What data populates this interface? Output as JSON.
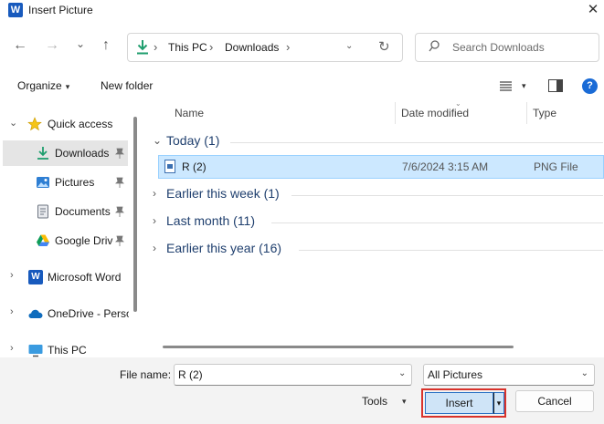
{
  "window": {
    "app_icon_letter": "W",
    "title": "Insert Picture",
    "close_glyph": "✕"
  },
  "nav": {
    "back_glyph": "←",
    "forward_glyph": "→",
    "recent_glyph": "⌄",
    "up_glyph": "↑",
    "address": [
      "This PC",
      "Downloads"
    ],
    "address_separator": "›",
    "address_dropdown_glyph": "⌄",
    "refresh_glyph": "↻",
    "search_placeholder": "Search Downloads"
  },
  "toolbar": {
    "organize": "Organize",
    "new_folder": "New folder",
    "caret": "▾",
    "help_glyph": "?"
  },
  "nav_pane": {
    "items": [
      {
        "label": "Quick access",
        "icon": "star-icon",
        "chevron": "⌄",
        "pinned": false
      },
      {
        "label": "Downloads",
        "icon": "download-icon",
        "chevron": "",
        "pinned": true,
        "selected": true
      },
      {
        "label": "Pictures",
        "icon": "pictures-icon",
        "chevron": "",
        "pinned": true
      },
      {
        "label": "Documents",
        "icon": "documents-icon",
        "chevron": "",
        "pinned": true
      },
      {
        "label": "Google Drive",
        "icon": "google-drive-icon",
        "chevron": "",
        "pinned": true
      },
      {
        "label": "Microsoft Word",
        "icon": "word-icon",
        "chevron": "›",
        "pinned": false
      },
      {
        "label": "OneDrive - Personal",
        "icon": "onedrive-icon",
        "chevron": "›",
        "pinned": false
      },
      {
        "label": "This PC",
        "icon": "this-pc-icon",
        "chevron": "›",
        "pinned": false
      }
    ]
  },
  "file_list": {
    "columns": [
      "Name",
      "Date modified",
      "Type"
    ],
    "groups": [
      {
        "label": "Today (1)",
        "chevron": "⌄"
      },
      {
        "label": "Earlier this week (1)",
        "chevron": "›"
      },
      {
        "label": "Last month (11)",
        "chevron": "›"
      },
      {
        "label": "Earlier this year (16)",
        "chevron": "›"
      }
    ],
    "files": [
      {
        "name": "R (2)",
        "date": "7/6/2024 3:15 AM",
        "type": "PNG File"
      }
    ]
  },
  "bottom": {
    "file_name_label": "File name:",
    "file_name_value": "R (2)",
    "file_type": "All Pictures",
    "chevron": "⌄",
    "tools": "Tools",
    "tools_caret": "▾",
    "insert": "Insert",
    "insert_split_caret": "▾",
    "cancel": "Cancel"
  },
  "colors": {
    "accent": "#1a6bd6",
    "selection": "#cce8ff",
    "highlight_border": "#d9322b",
    "group_text": "#1f3f6e"
  }
}
